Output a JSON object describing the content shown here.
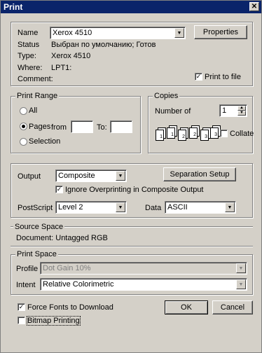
{
  "window": {
    "title": "Print",
    "close_label": "✕"
  },
  "printer": {
    "name_label": "Name",
    "name_value": "Xerox 4510",
    "properties_label": "Properties",
    "status_label": "Status",
    "status_value": "Выбран по умолчанию; Готов",
    "type_label": "Type:",
    "type_value": "Xerox 4510",
    "where_label": "Where:",
    "where_value": "LPT1:",
    "comment_label": "Comment:",
    "print_to_file_label": "Print to file",
    "print_to_file_checked": true
  },
  "print_range": {
    "legend": "Print Range",
    "all_label": "All",
    "pages_label": "Pages",
    "from_label": "from",
    "to_label": "To:",
    "from_value": "",
    "to_value": "",
    "selection_label": "Selection",
    "selected": "pages"
  },
  "copies": {
    "legend": "Copies",
    "number_label": "Number of",
    "number_value": "1",
    "collate_label": "Collate",
    "collate_checked": false,
    "page_numbers": [
      "1",
      "1",
      "2",
      "2",
      "3",
      "3"
    ]
  },
  "output": {
    "output_label": "Output",
    "output_value": "Composite",
    "separation_setup_label": "Separation Setup",
    "ignore_overprinting_label": "Ignore Overprinting in Composite Output",
    "ignore_overprinting_checked": true,
    "postscript_label": "PostScript",
    "postscript_value": "Level 2",
    "data_label": "Data",
    "data_value": "ASCII"
  },
  "source_space": {
    "legend": "Source Space",
    "value": "Document: Untagged RGB"
  },
  "print_space": {
    "legend": "Print Space",
    "profile_label": "Profile",
    "profile_value": "Dot Gain 10%",
    "intent_label": "Intent",
    "intent_value": "Relative Colorimetric"
  },
  "footer": {
    "force_fonts_label": "Force Fonts to Download",
    "force_fonts_checked": true,
    "bitmap_printing_label": "Bitmap Printing",
    "bitmap_printing_checked": false,
    "ok_label": "OK",
    "cancel_label": "Cancel"
  },
  "icons": {
    "checkmark": "✓",
    "dropdown_arrow": "▼",
    "spin_up": "▲",
    "spin_down": "▼"
  }
}
